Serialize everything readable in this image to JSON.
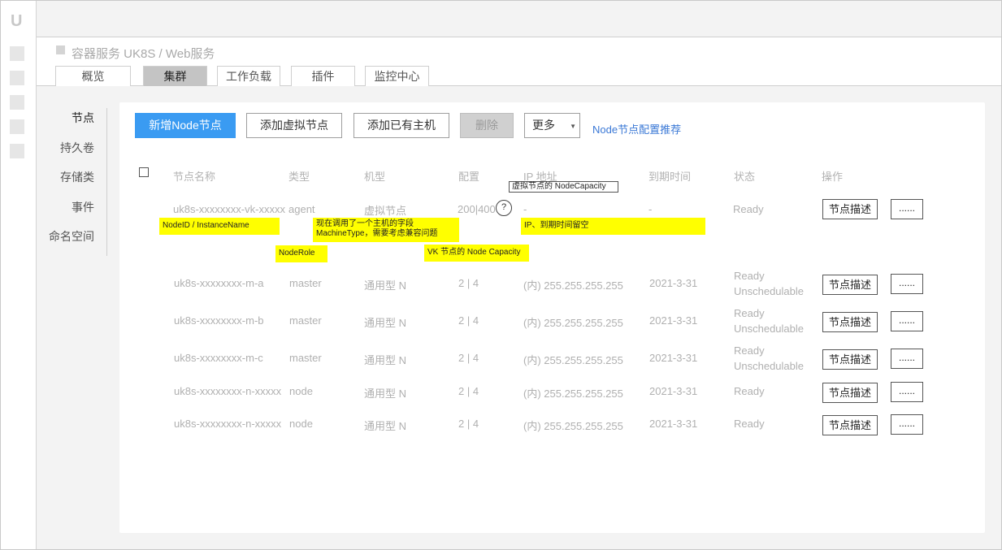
{
  "app": {
    "logo": "U"
  },
  "breadcrumb": "容器服务 UK8S / Web服务",
  "tabs": [
    "概览",
    "集群",
    "工作负载",
    "插件",
    "监控中心"
  ],
  "active_tab": "集群",
  "side_menu": [
    "节点",
    "持久卷",
    "存储类",
    "事件",
    "命名空间"
  ],
  "toolbar": {
    "add_node": "新增Node节点",
    "add_virtual": "添加虚拟节点",
    "add_existing": "添加已有主机",
    "delete": "删除",
    "more": "更多",
    "config_link": "Node节点配置推荐"
  },
  "table": {
    "headers": [
      "节点名称",
      "类型",
      "机型",
      "配置",
      "IP 地址",
      "到期时间",
      "状态",
      "操作"
    ],
    "rows": [
      {
        "name": "uk8s-xxxxxxxx-vk-xxxxx",
        "type": "agent",
        "model": "虚拟节点",
        "config": "200|400",
        "ip": "-",
        "expire": "-",
        "status": [
          "Ready"
        ]
      },
      {
        "name": "uk8s-xxxxxxxx-m-a",
        "type": "master",
        "model": "通用型 N",
        "config": "2 | 4",
        "ip": "(内) 255.255.255.255",
        "expire": "2021-3-31",
        "status": [
          "Ready",
          "Unschedulable"
        ]
      },
      {
        "name": "uk8s-xxxxxxxx-m-b",
        "type": "master",
        "model": "通用型 N",
        "config": "2 | 4",
        "ip": "(内) 255.255.255.255",
        "expire": "2021-3-31",
        "status": [
          "Ready",
          "Unschedulable"
        ]
      },
      {
        "name": "uk8s-xxxxxxxx-m-c",
        "type": "master",
        "model": "通用型 N",
        "config": "2 | 4",
        "ip": "(内) 255.255.255.255",
        "expire": "2021-3-31",
        "status": [
          "Ready",
          "Unschedulable"
        ]
      },
      {
        "name": "uk8s-xxxxxxxx-n-xxxxx",
        "type": "node",
        "model": "通用型 N",
        "config": "2 | 4",
        "ip": "(内) 255.255.255.255",
        "expire": "2021-3-31",
        "status": [
          "Ready"
        ]
      },
      {
        "name": "uk8s-xxxxxxxx-n-xxxxx",
        "type": "node",
        "model": "通用型 N",
        "config": "2 | 4",
        "ip": "(内) 255.255.255.255",
        "expire": "2021-3-31",
        "status": [
          "Ready"
        ]
      }
    ],
    "action_describe": "节点描述",
    "action_more": "......",
    "help_icon": "?"
  },
  "annotations": {
    "vk_capacity_box": "虚拟节点的 NodeCapacity",
    "node_id": "NodeID / InstanceName",
    "machine_type_line1": "现在调用了一个主机的字段",
    "machine_type_line2": "MachineType，需要考虑兼容问题",
    "ip_expire": "IP、到期时间留空",
    "node_role": "NodeRole",
    "vk_capacity": "VK 节点的 Node Capacity"
  },
  "colors": {
    "primary": "#3a9bf2",
    "link": "#3a78d6",
    "note": "#ffff00"
  }
}
